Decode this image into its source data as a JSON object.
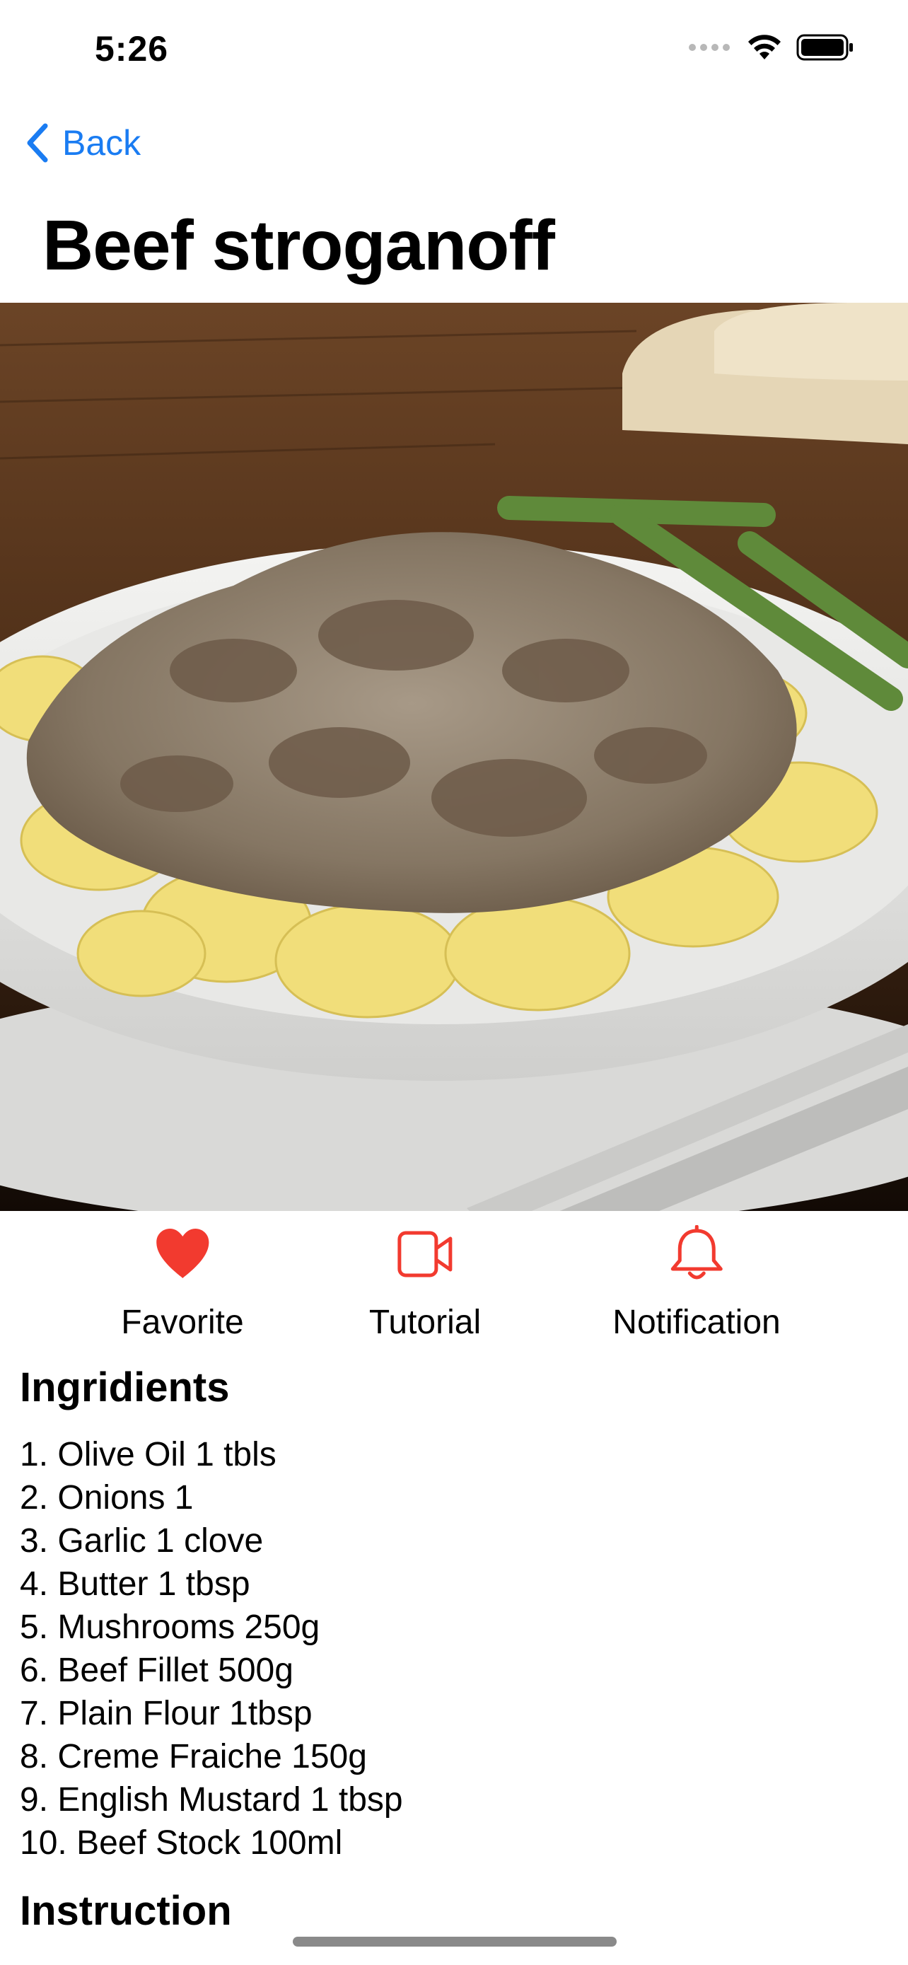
{
  "status_bar": {
    "time": "5:26",
    "icons": [
      "cellular-signal-icon",
      "wifi-icon",
      "battery-icon"
    ]
  },
  "nav": {
    "back_label": "Back",
    "back_icon": "chevron-left-icon"
  },
  "recipe": {
    "title": "Beef stroganoff",
    "image_alt": "Beef stroganoff with egg noodles and asparagus"
  },
  "actions": [
    {
      "label": "Favorite",
      "icon": "heart-icon"
    },
    {
      "label": "Tutorial",
      "icon": "video-camera-icon"
    },
    {
      "label": "Notification",
      "icon": "bell-icon"
    }
  ],
  "ingredients": {
    "heading": "Ingridients",
    "items": [
      "1. Olive Oil 1 tbls",
      "2. Onions 1",
      "3. Garlic 1 clove",
      "4. Butter 1 tbsp",
      "5. Mushrooms 250g",
      "6. Beef Fillet 500g",
      "7. Plain Flour 1tbsp",
      "8. Creme Fraiche 150g",
      "9. English Mustard 1 tbsp",
      "10. Beef Stock 100ml"
    ]
  },
  "instruction": {
    "heading": "Instruction"
  },
  "colors": {
    "accent_blue": "#1a7cf2",
    "action_red": "#f23a2f"
  }
}
